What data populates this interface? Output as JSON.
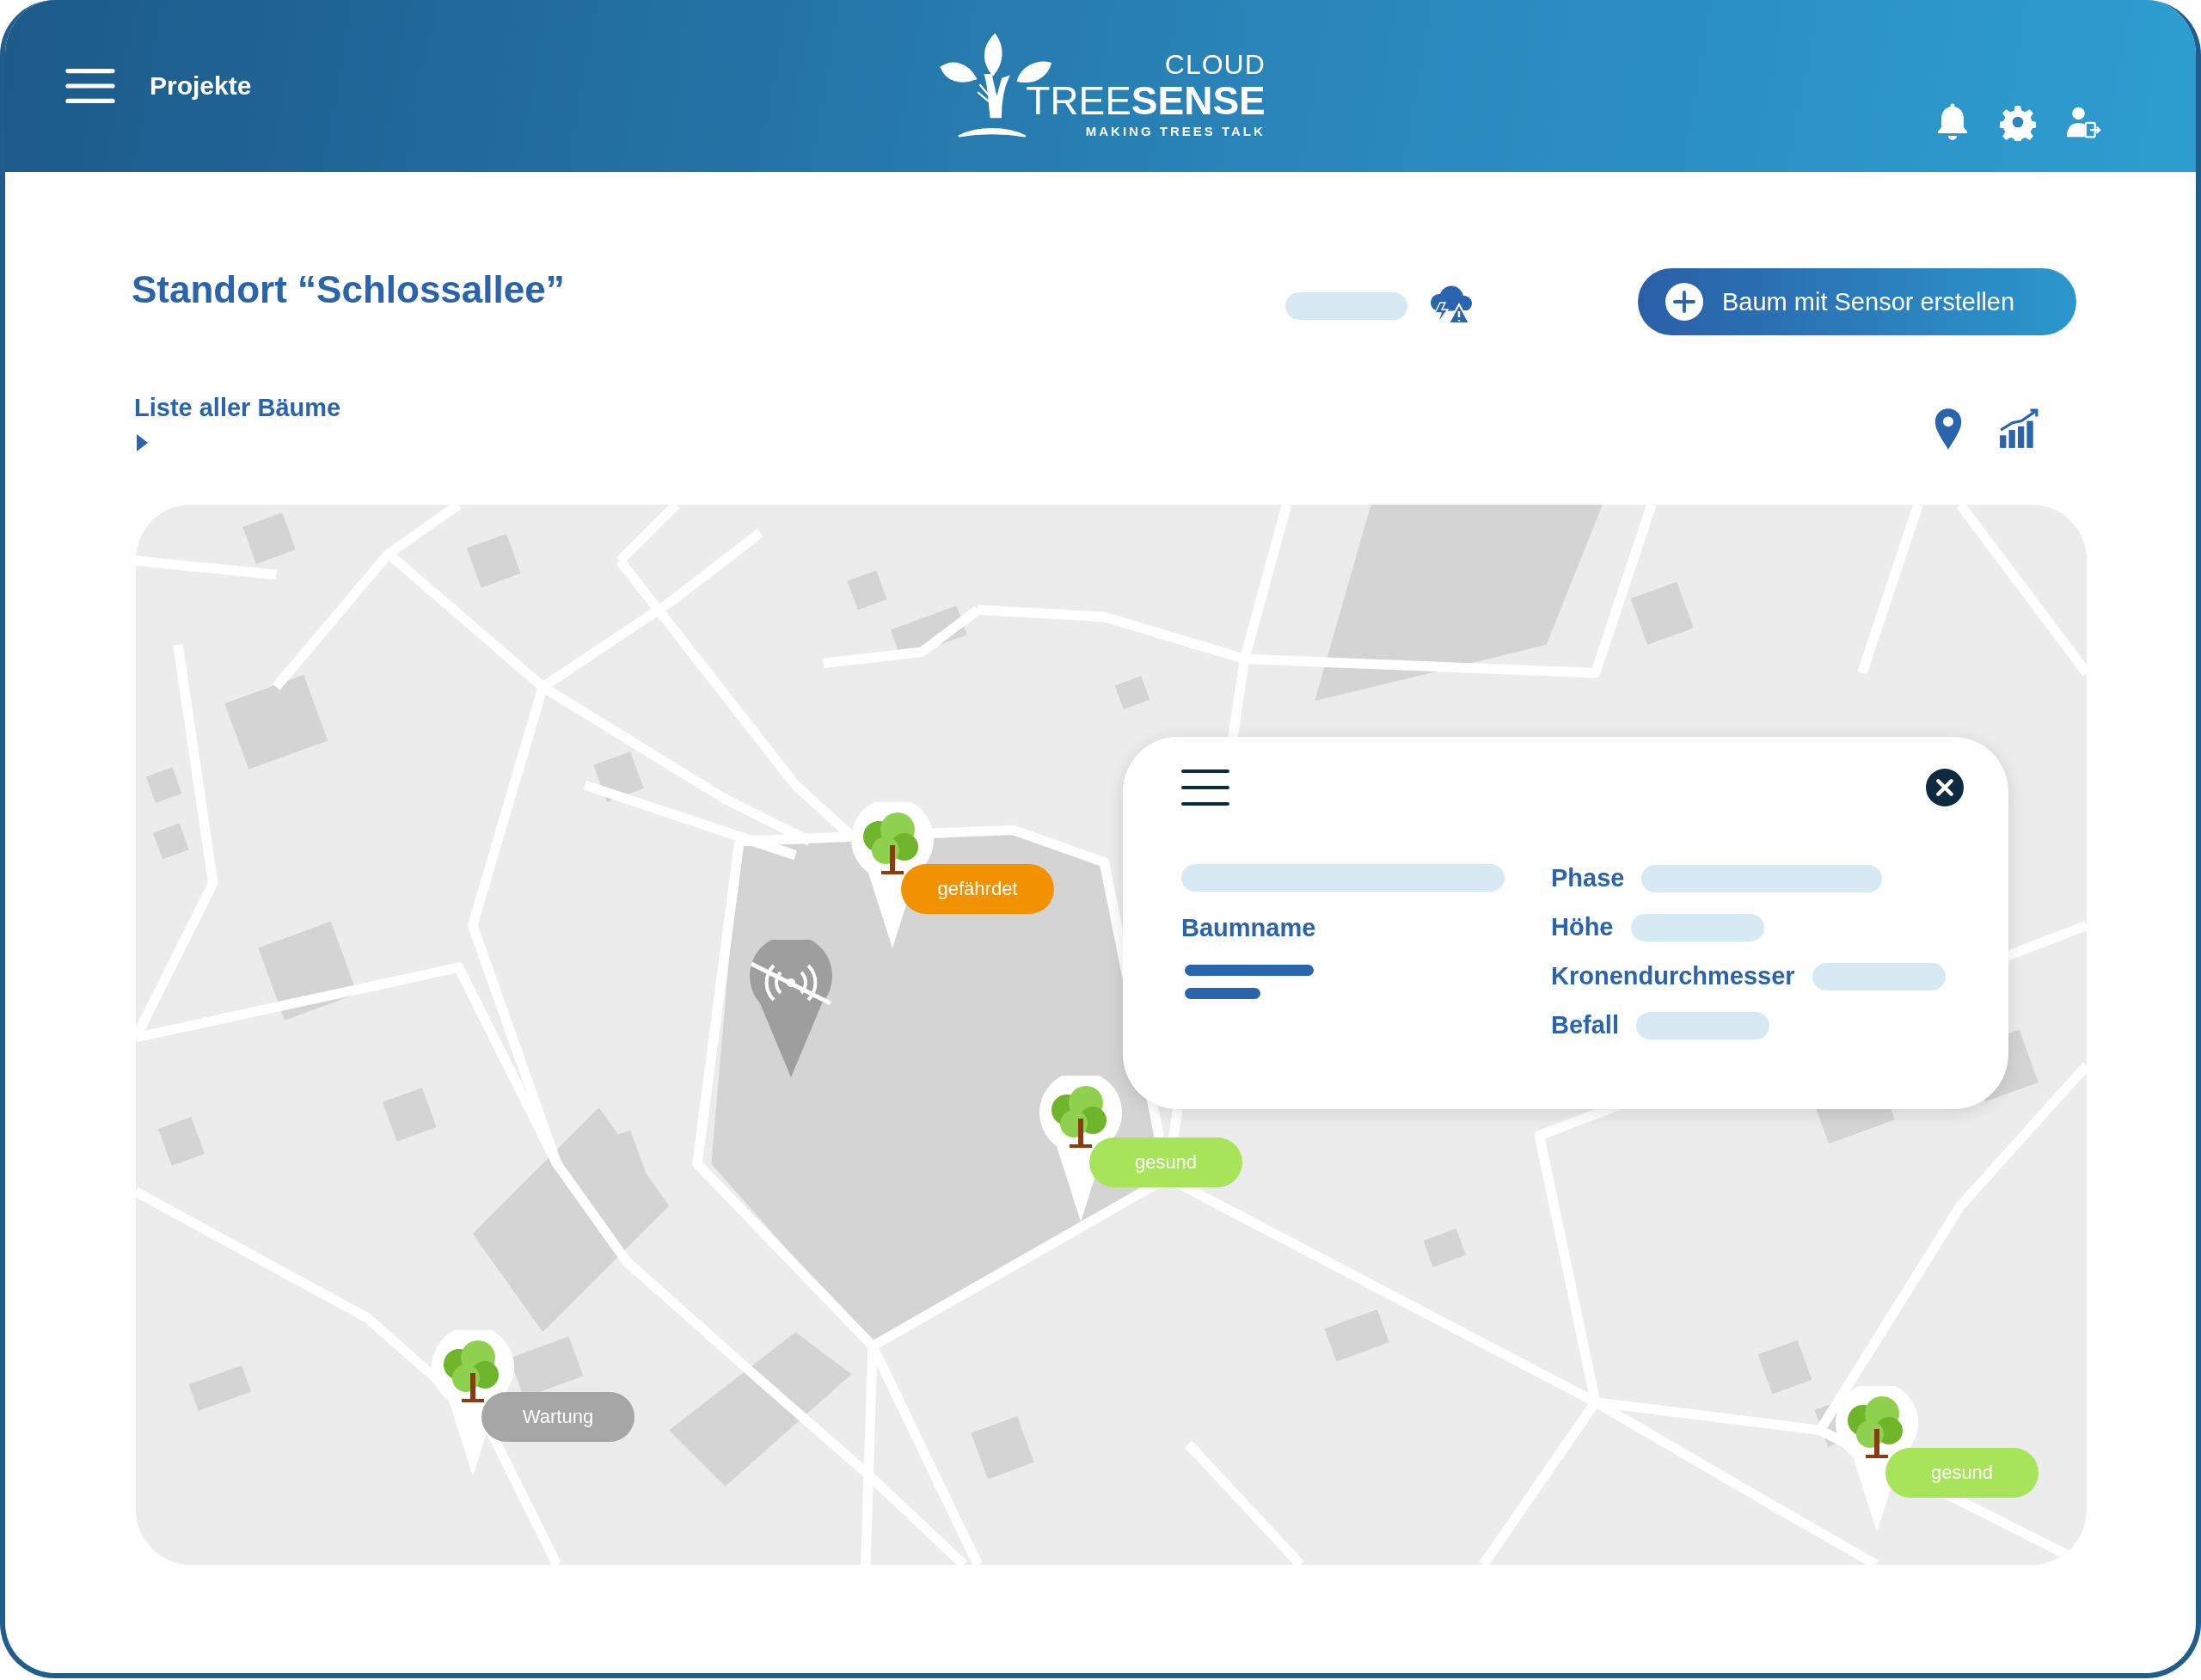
{
  "header": {
    "menu_label": "Projekte",
    "logo": {
      "cloud": "CLOUD",
      "name": "TREE**SENSE**",
      "tagline": "MAKING TREES TALK"
    }
  },
  "page": {
    "title": "Standort “Schlossallee”",
    "create_button": "Baum mit Sensor erstellen",
    "list_toggle": {
      "label": "Liste aller Bäume",
      "expanded": false
    }
  },
  "map": {
    "markers": [
      {
        "kind": "tree",
        "status": "gefährdet",
        "color": "#f39200"
      },
      {
        "kind": "signal-off"
      },
      {
        "kind": "tree",
        "status": "gesund",
        "color": "#a8e45a"
      },
      {
        "kind": "tree",
        "status": "Wartung",
        "color": "#a6a6a6"
      },
      {
        "kind": "tree",
        "status": "gesund",
        "color": "#a8e45a"
      }
    ]
  },
  "detail_popup": {
    "name_label": "Baumname",
    "fields": [
      "Phase",
      "Höhe",
      "Kronendurchmesser",
      "Befall"
    ]
  }
}
